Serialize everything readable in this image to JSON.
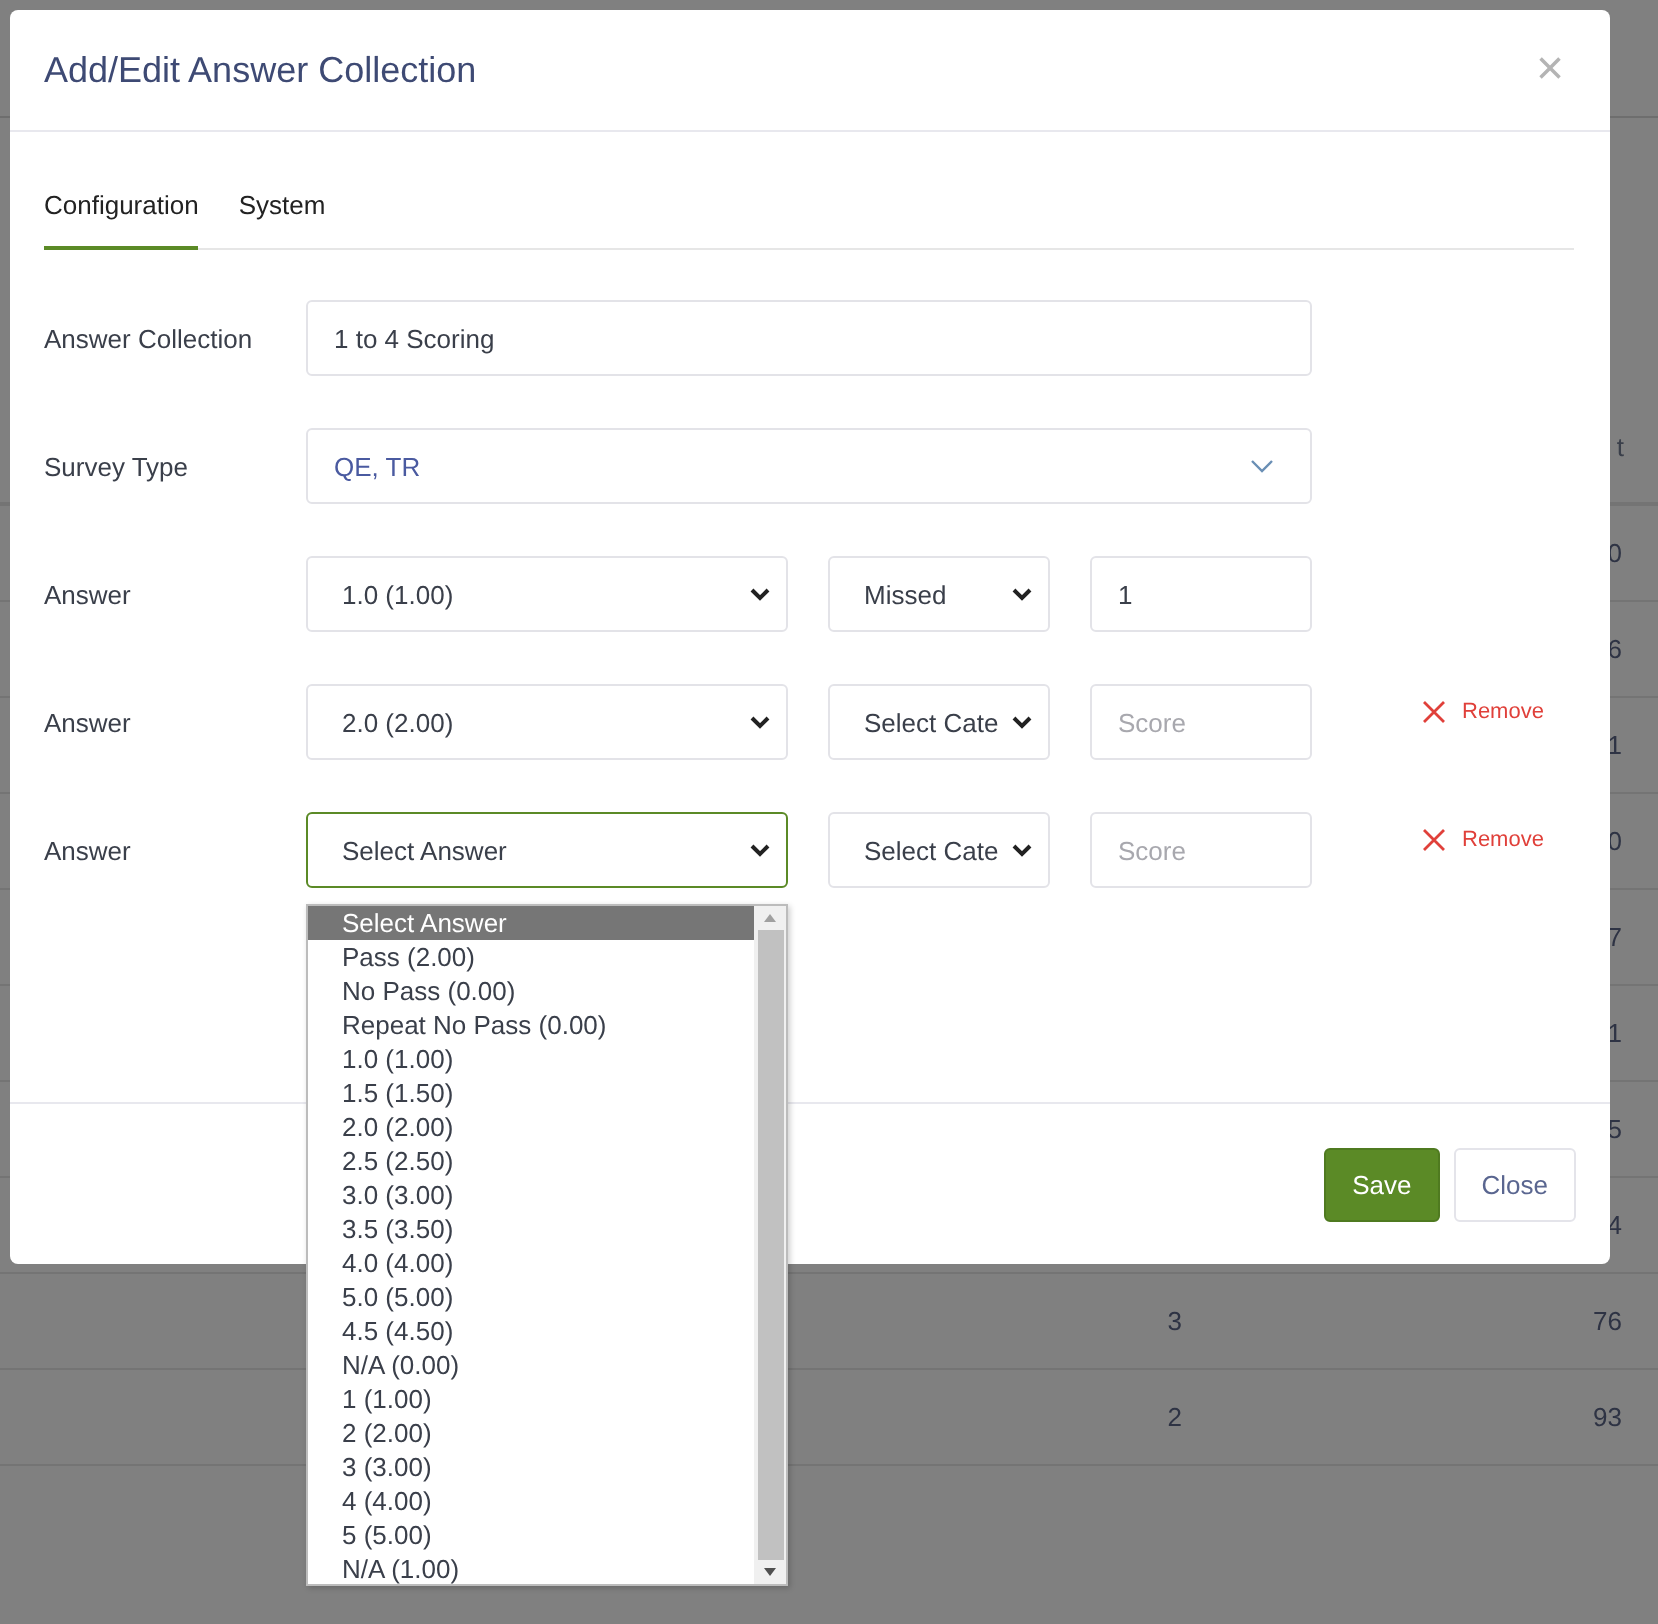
{
  "background": {
    "header_fragment": "t",
    "rows": [
      {
        "column_3": "0"
      },
      {
        "column_3": "6"
      },
      {
        "column_3": "1"
      },
      {
        "column_3": "0"
      },
      {
        "column_3": "7"
      },
      {
        "column_3": "1"
      },
      {
        "column_3": "5"
      },
      {
        "column_3": "4"
      },
      {
        "column_2": "3",
        "column_3": "76"
      },
      {
        "column_2": "2",
        "column_3": "93"
      }
    ]
  },
  "dialog": {
    "title": "Add/Edit Answer Collection",
    "close": "×",
    "tabs": [
      {
        "label": "Configuration",
        "selected": true
      },
      {
        "label": "System",
        "selected": false
      }
    ],
    "answer_collection": {
      "label": "Answer Collection",
      "value": "1 to 4 Scoring"
    },
    "survey_type": {
      "label": "Survey Type",
      "value": "QE, TR"
    },
    "answers": [
      {
        "label": "Answer",
        "answer": "1.0 (1.00)",
        "category": "Missed",
        "score": "1",
        "focused": false
      },
      {
        "label": "Answer",
        "answer": "2.0 (2.00)",
        "category": "Select Cate",
        "score_placeholder": "Score",
        "focused": false,
        "remove": "Remove"
      },
      {
        "label": "Answer",
        "answer": "Select Answer",
        "category": "Select Cate",
        "score_placeholder": "Score",
        "focused": true,
        "remove": "Remove"
      }
    ],
    "buttons": [
      {
        "kind": "primary",
        "label": "Save"
      },
      {
        "kind": "secondary",
        "label": "Close"
      }
    ]
  },
  "dropdown": {
    "options": [
      {
        "label": "Select Answer",
        "selected": true
      },
      {
        "label": "Pass (2.00)",
        "selected": false
      },
      {
        "label": "No Pass (0.00)",
        "selected": false
      },
      {
        "label": "Repeat No Pass (0.00)",
        "selected": false
      },
      {
        "label": "1.0 (1.00)",
        "selected": false
      },
      {
        "label": "1.5 (1.50)",
        "selected": false
      },
      {
        "label": "2.0 (2.00)",
        "selected": false
      },
      {
        "label": "2.5 (2.50)",
        "selected": false
      },
      {
        "label": "3.0 (3.00)",
        "selected": false
      },
      {
        "label": "3.5 (3.50)",
        "selected": false
      },
      {
        "label": "4.0 (4.00)",
        "selected": false
      },
      {
        "label": "5.0 (5.00)",
        "selected": false
      },
      {
        "label": "4.5 (4.50)",
        "selected": false
      },
      {
        "label": "N/A (0.00)",
        "selected": false
      },
      {
        "label": "1 (1.00)",
        "selected": false
      },
      {
        "label": "2 (2.00)",
        "selected": false
      },
      {
        "label": "3 (3.00)",
        "selected": false
      },
      {
        "label": "4 (4.00)",
        "selected": false
      },
      {
        "label": "5 (5.00)",
        "selected": false
      },
      {
        "label": "N/A (1.00)",
        "selected": false
      }
    ]
  }
}
